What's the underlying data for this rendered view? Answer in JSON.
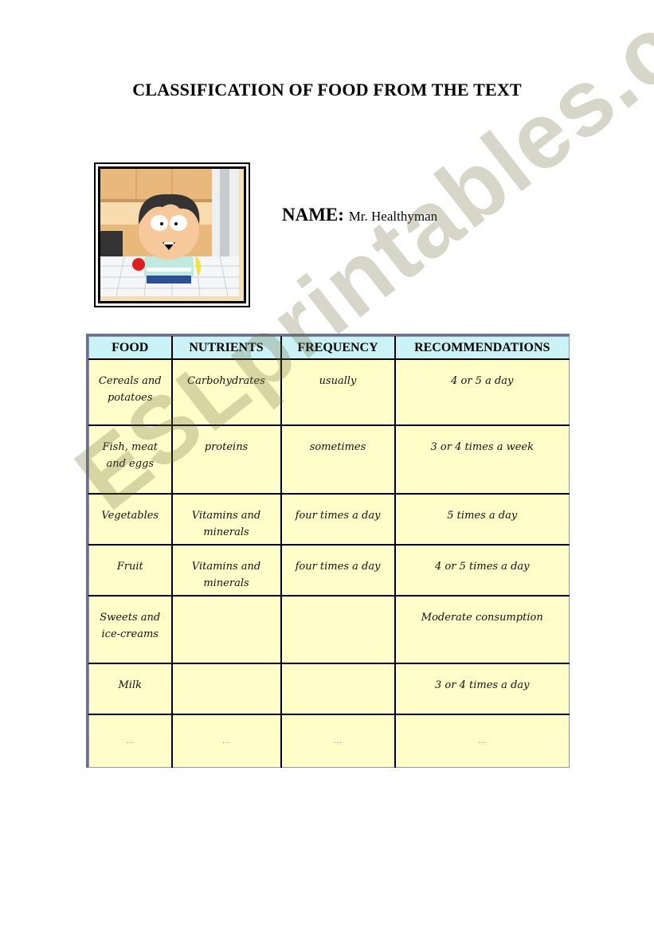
{
  "document": {
    "title": "CLASSIFICATION OF FOOD FROM THE TEXT",
    "name_label": "NAME:",
    "name_value": "Mr. Healthyman",
    "picture": "cartoon-boy-kitchen-image"
  },
  "table": {
    "headers": [
      "FOOD",
      "NUTRIENTS",
      "FREQUENCY",
      "RECOMMENDATIONS"
    ],
    "rows": [
      [
        "Cereals and potatoes",
        "Carbohydrates",
        "usually",
        "4 or 5 a day"
      ],
      [
        "Fish, meat and eggs",
        "proteins",
        "sometimes",
        "3 or 4 times a week"
      ],
      [
        "Vegetables",
        "Vitamins and minerals",
        "four times a day",
        "5 times a day"
      ],
      [
        "Fruit",
        "Vitamins and minerals",
        "four times a day",
        "4 or 5 times a day"
      ],
      [
        "Sweets and ice-creams",
        "",
        "",
        "Moderate consumption"
      ],
      [
        "Milk",
        "",
        "",
        "3 or 4 times a day"
      ],
      [
        "…",
        "…",
        "…",
        "…"
      ]
    ]
  },
  "watermark": "ESLprintables.com",
  "colors": {
    "header_bg": "#c9f3f7",
    "cell_bg": "#fffdc8",
    "table_frame": "#6e6e94"
  }
}
